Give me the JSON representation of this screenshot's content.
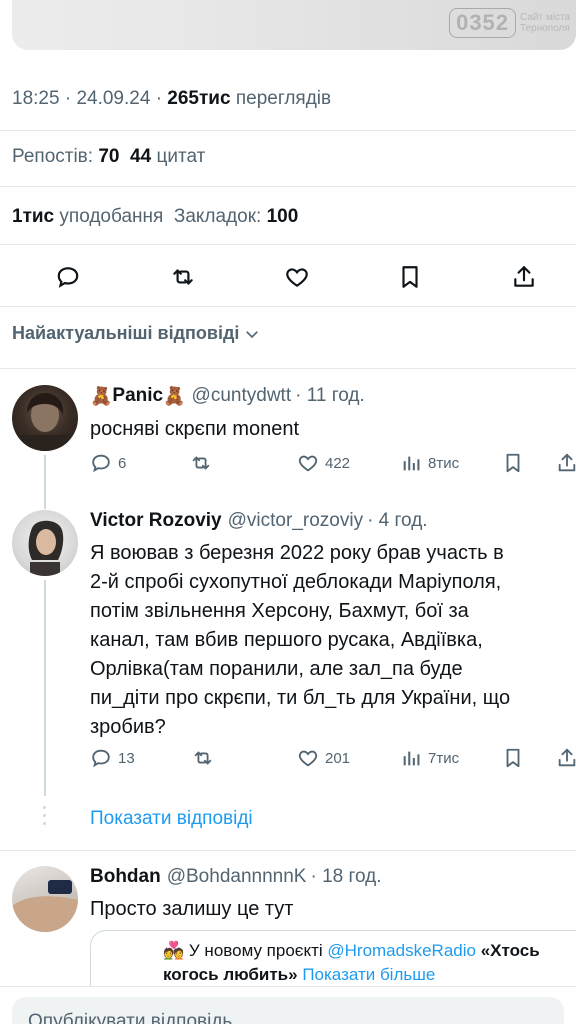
{
  "media": {
    "watermark_logo": "0352",
    "watermark_text_1": "Сайт міста",
    "watermark_text_2": "Тернополя"
  },
  "tweet": {
    "time": "18:25",
    "sep1": "·",
    "date": "24.09.24",
    "sep2": "·",
    "views_count": "265тис",
    "views_label": "переглядів",
    "reposts_label": "Репостів:",
    "reposts_count": "70",
    "quotes_count": "44",
    "quotes_label": "цитат",
    "likes_count": "1тис",
    "likes_label": "уподобання",
    "bookmarks_label": "Закладок:",
    "bookmarks_count": "100"
  },
  "actions": [
    "reply-icon",
    "retweet-icon",
    "like-icon",
    "bookmark-icon",
    "share-icon"
  ],
  "sort_label": "Найактуальніші відповіді",
  "replies": [
    {
      "emoji_left": "🧸",
      "name": "Panic",
      "emoji_right": "🧸",
      "handle": "@cuntydwtt",
      "time": "· 11 год.",
      "text": "росняві скрєпи monent",
      "stats": {
        "replies": "6",
        "retweets": "",
        "likes": "422",
        "views": "8тис"
      }
    },
    {
      "name": "Victor Rozoviy",
      "handle": "@victor_rozoviy",
      "time": "· 4 год.",
      "lines": [
        "Я воював з березня 2022 року брав участь в",
        "2-й спробі сухопутної деблокади Маріуполя,",
        "потім звільнення Херсону, Бахмут, бої за",
        "канал, там вбив першого русака, Авдіївка,",
        "Орлівка(там поранили, але зал_па буде",
        "пи_діти про скрєпи, ти бл_ть для України, що",
        "зробив?"
      ],
      "stats": {
        "replies": "13",
        "retweets": "",
        "likes": "201",
        "views": "7тис"
      }
    },
    {
      "name": "Bohdan",
      "handle": "@BohdannnnnK",
      "time": "· 18 год.",
      "text": "Просто залишу це тут",
      "quote": {
        "emoji": "💑",
        "part1": "У новому проєкті ",
        "mention": "@HromadskeRadio",
        "title": " «Хтось",
        "line2_bold": "когось любить»",
        "more": " Показати більше"
      }
    }
  ],
  "show_replies": "Показати відповіді",
  "composer_placeholder": "Опублікувати відповідь",
  "colors": {
    "accent": "#1d9bf0",
    "secondary_text": "#536471",
    "primary_text": "#0f1419"
  }
}
